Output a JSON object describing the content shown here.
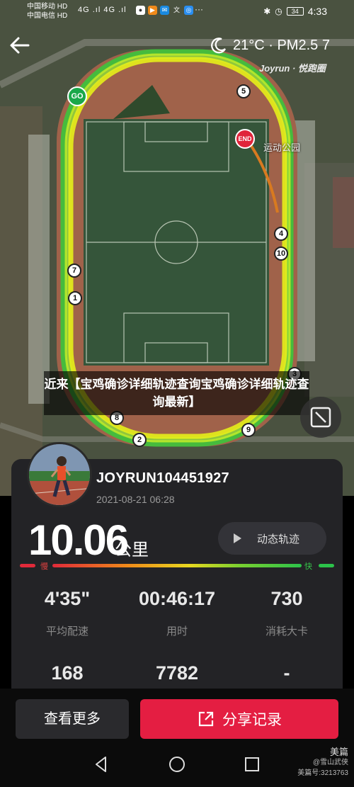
{
  "status_bar": {
    "carrier1": "中国移动 HD",
    "carrier2": "中国电信 HD",
    "signal": "4G .ıl 4G .ıl",
    "dots": "···",
    "battery": "34",
    "time": "4:33"
  },
  "map": {
    "weather": "21°C · PM2.5 7",
    "brand": "Joyrun · 悦跑圈",
    "park_label": "运动公园",
    "go_label": "GO",
    "end_label": "END",
    "km_markers": [
      "1",
      "2",
      "3",
      "4",
      "5",
      "7",
      "8",
      "9",
      "10"
    ]
  },
  "headline": "近来【宝鸡确诊详细轨迹查询宝鸡确诊详细轨迹查询最新】",
  "run": {
    "username": "JOYRUN104451927",
    "datetime": "2021-08-21 06:28",
    "distance": "10.06",
    "distance_unit": "公里",
    "track_button": "动态轨迹",
    "slow_label": "慢",
    "fast_label": "快"
  },
  "stats": [
    {
      "value": "4'35\"",
      "label": "平均配速"
    },
    {
      "value": "00:46:17",
      "label": "用时"
    },
    {
      "value": "730",
      "label": "消耗大卡"
    },
    {
      "value": "168",
      "label": ""
    },
    {
      "value": "7782",
      "label": ""
    },
    {
      "value": "-",
      "label": ""
    }
  ],
  "buttons": {
    "more": "查看更多",
    "share": "分享记录"
  },
  "watermark": {
    "title": "美篇",
    "author": "@雪山武侠",
    "id": "美篇号:3213763"
  },
  "colors": {
    "accent_red": "#e41e42",
    "go_green": "#1aa84a",
    "track_yellow": "#e6f01a",
    "track_green": "#3cc53c"
  }
}
